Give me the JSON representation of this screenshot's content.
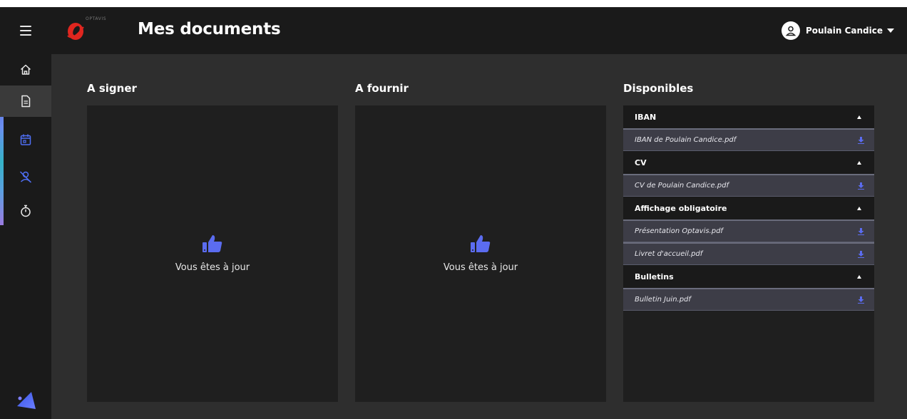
{
  "header": {
    "page_title": "Mes documents",
    "logo_text": "OPTAVIS",
    "user_name": "Poulain Candice"
  },
  "sidebar": {
    "items": [
      {
        "icon": "home-icon"
      },
      {
        "icon": "document-icon",
        "active": true
      },
      {
        "icon": "calendar-icon"
      },
      {
        "icon": "user-off-icon"
      },
      {
        "icon": "stopwatch-icon"
      }
    ]
  },
  "sections": {
    "sign": {
      "title": "A signer",
      "empty_text": "Vous êtes à jour"
    },
    "provide": {
      "title": "A fournir",
      "empty_text": "Vous êtes à jour"
    },
    "available": {
      "title": "Disponibles"
    }
  },
  "available_groups": [
    {
      "label": "IBAN",
      "files": [
        "IBAN de Poulain Candice.pdf"
      ]
    },
    {
      "label": "CV",
      "files": [
        "CV de Poulain Candice.pdf"
      ]
    },
    {
      "label": "Affichage obligatoire",
      "files": [
        "Présentation Optavis.pdf",
        "Livret d'accueil.pdf"
      ]
    },
    {
      "label": "Bulletins",
      "files": [
        "Bulletin Juin.pdf"
      ]
    }
  ],
  "colors": {
    "accent": "#5b6cf0",
    "topbar_bg": "#1a1a1a",
    "page_bg": "#2e2e2e",
    "panel_bg": "#1f1f1f",
    "logo_red": "#e0261f"
  }
}
